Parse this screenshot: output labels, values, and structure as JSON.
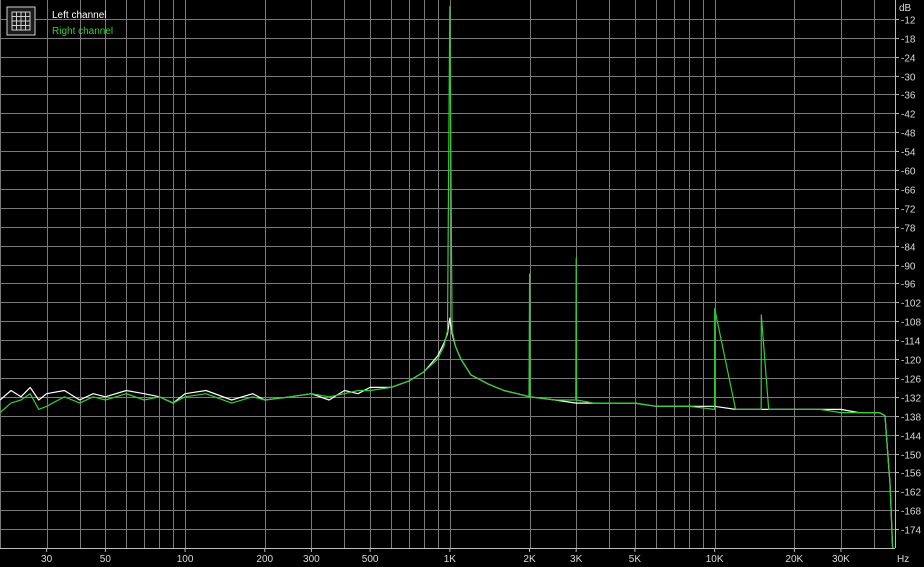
{
  "chart_data": {
    "type": "line",
    "title": "",
    "xlabel": "Hz",
    "ylabel": "dB",
    "x_scale": "log",
    "xlim": [
      20,
      48000
    ],
    "ylim": [
      -180,
      -6
    ],
    "grid": true,
    "legend_position": "top-left",
    "x_ticks": [
      {
        "value": 30,
        "label": "30"
      },
      {
        "value": 50,
        "label": "50"
      },
      {
        "value": 100,
        "label": "100"
      },
      {
        "value": 200,
        "label": "200"
      },
      {
        "value": 300,
        "label": "300"
      },
      {
        "value": 500,
        "label": "500"
      },
      {
        "value": 1000,
        "label": "1K"
      },
      {
        "value": 2000,
        "label": "2K"
      },
      {
        "value": 3000,
        "label": "3K"
      },
      {
        "value": 5000,
        "label": "5K"
      },
      {
        "value": 10000,
        "label": "10K"
      },
      {
        "value": 20000,
        "label": "20K"
      },
      {
        "value": 30000,
        "label": "30K"
      }
    ],
    "y_ticks": [
      -12,
      -18,
      -24,
      -30,
      -36,
      -42,
      -48,
      -54,
      -60,
      -66,
      -72,
      -78,
      -84,
      -90,
      -96,
      -102,
      -108,
      -114,
      -120,
      -126,
      -132,
      -138,
      -144,
      -150,
      -156,
      -162,
      -168,
      -174
    ],
    "series": [
      {
        "name": "Left channel",
        "color": "#ffffff",
        "x": [
          20,
          22,
          24,
          26,
          28,
          30,
          35,
          40,
          45,
          50,
          60,
          70,
          80,
          90,
          100,
          120,
          150,
          180,
          200,
          250,
          300,
          350,
          400,
          450,
          500,
          600,
          700,
          800,
          900,
          950,
          980,
          1000,
          1020,
          1050,
          1100,
          1200,
          1400,
          1600,
          1800,
          2000,
          2500,
          3000,
          4000,
          5000,
          6000,
          8000,
          10000,
          12000,
          15000,
          20000,
          25000,
          30000,
          35000,
          40000,
          42000,
          44000,
          46000,
          47000
        ],
        "y": [
          -133,
          -130,
          -132,
          -129,
          -133,
          -131,
          -130,
          -133,
          -131,
          -132,
          -130,
          -131,
          -132,
          -134,
          -131,
          -130,
          -133,
          -131,
          -133,
          -132,
          -131,
          -133,
          -130,
          -131,
          -129,
          -129,
          -127,
          -124,
          -119,
          -115,
          -112,
          -107,
          -112,
          -116,
          -120,
          -125,
          -128,
          -130,
          -131,
          -132,
          -133,
          -134,
          -134,
          -134,
          -135,
          -135,
          -135,
          -136,
          -136,
          -136,
          -136,
          -136,
          -137,
          -137,
          -137,
          -138,
          -160,
          -180
        ]
      },
      {
        "name": "Right channel",
        "color": "#33cc33",
        "x": [
          20,
          22,
          24,
          26,
          28,
          30,
          35,
          40,
          45,
          50,
          60,
          70,
          80,
          90,
          100,
          120,
          150,
          180,
          200,
          250,
          300,
          350,
          400,
          450,
          500,
          600,
          700,
          800,
          900,
          950,
          980,
          1000,
          1020,
          1050,
          1100,
          1200,
          1400,
          1600,
          1800,
          1990,
          2000,
          2010,
          2500,
          2990,
          3000,
          3010,
          3500,
          4000,
          4500,
          5000,
          6000,
          8000,
          10000,
          10010,
          12000,
          14000,
          15000,
          15010,
          16000,
          20000,
          25000,
          30000,
          35000,
          40000,
          42000,
          44000,
          46000,
          47000
        ],
        "y": [
          -137,
          -134,
          -133,
          -131,
          -136,
          -135,
          -132,
          -134,
          -132,
          -133,
          -131,
          -133,
          -132,
          -134,
          -132,
          -131,
          -134,
          -132,
          -133,
          -132,
          -131,
          -132,
          -131,
          -130,
          -130,
          -129,
          -127,
          -124,
          -120,
          -116,
          -111,
          -8,
          -111,
          -116,
          -120,
          -125,
          -128,
          -130,
          -131,
          -132,
          -93,
          -132,
          -133,
          -133,
          -88,
          -133,
          -134,
          -134,
          -134,
          -134,
          -135,
          -135,
          -136,
          -104,
          -136,
          -136,
          -136,
          -106,
          -136,
          -136,
          -136,
          -137,
          -137,
          -137,
          -137,
          -138,
          -160,
          -180
        ]
      }
    ]
  },
  "legend": {
    "items": [
      {
        "label": "Left channel",
        "color": "#ffffff"
      },
      {
        "label": "Right channel",
        "color": "#33cc33"
      }
    ]
  },
  "axis": {
    "y_unit": "dB",
    "x_unit": "Hz"
  }
}
